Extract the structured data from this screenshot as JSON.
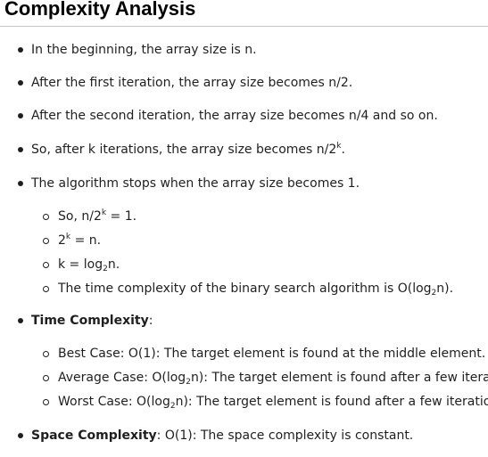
{
  "title": "Complexity Analysis",
  "items": [
    "In the beginning, the array size is n.",
    "After the first iteration, the array size becomes n/2.",
    "After the second iteration, the array size becomes n/4 and so on.",
    {
      "pre": "So, after k iterations, the array size becomes n/2",
      "sup": "k",
      "post": "."
    },
    "The algorithm stops when the array size becomes 1."
  ],
  "sub_items": [
    {
      "pre": "So, n/2",
      "sup": "k",
      "post": " = 1."
    },
    {
      "base": "2",
      "sup": "k",
      "post": " = n."
    },
    {
      "pre": "k = log",
      "sub": "2",
      "post": "n."
    },
    {
      "pre": "The time complexity of the binary search algorithm is O(log",
      "sub": "2",
      "post": "n)."
    }
  ],
  "time_complexity": {
    "label": "Time Complexity",
    "suffix": ":",
    "cases": [
      {
        "pre": "Best Case: O(1): The target element is found at the middle element."
      },
      {
        "pre": "Average Case: O(log",
        "sub": "2",
        "post": "n): The target element is found after a few iterations"
      },
      {
        "pre": "Worst Case: O(log",
        "sub": "2",
        "post": "n): The target element is found after a few iterations."
      }
    ]
  },
  "space_complexity": {
    "label": "Space Complexity",
    "text": ": O(1): The space complexity is constant."
  }
}
